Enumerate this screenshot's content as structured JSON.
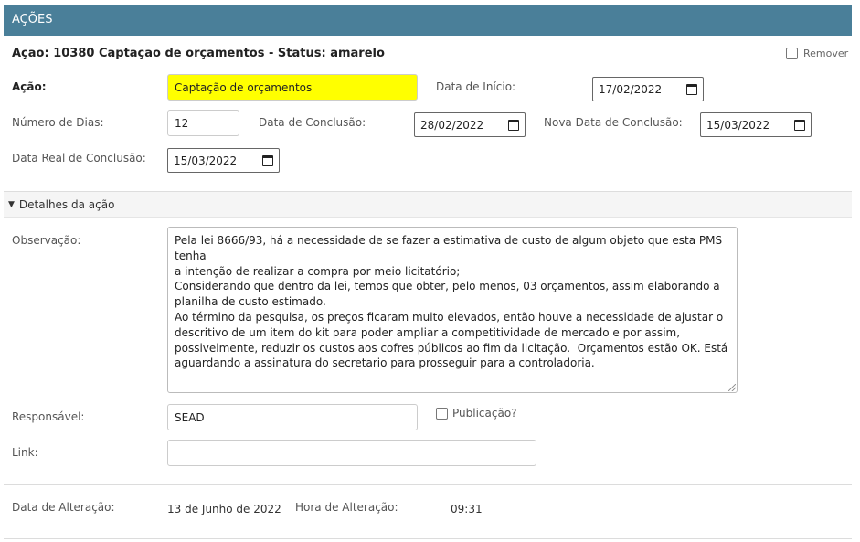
{
  "header": {
    "title": "AÇÕES"
  },
  "action": {
    "title": "Ação: 10380 Captação de orçamentos - Status: amarelo",
    "remove_label": "Remover",
    "acao_label": "Ação:",
    "acao_value": "Captação de orçamentos",
    "data_inicio_label": "Data de Início:",
    "data_inicio_value": "17/02/2022",
    "numero_dias_label": "Número de Dias:",
    "numero_dias_value": "12",
    "data_conclusao_label": "Data de Conclusão:",
    "data_conclusao_value": "28/02/2022",
    "nova_data_label": "Nova Data de Conclusão:",
    "nova_data_value": "15/03/2022",
    "data_real_label": "Data Real de Conclusão:",
    "data_real_value": "15/03/2022"
  },
  "details": {
    "toggle_label": "Detalhes da ação",
    "observacao_label": "Observação:",
    "observacao_lines": [
      "Pela lei 8666/93, há a necessidade de se fazer a estimativa de custo de algum objeto que esta PMS tenha",
      "a intenção de realizar a compra por meio licitatório;",
      "Considerando que dentro da lei, temos que obter, pelo menos, 03 orçamentos, assim elaborando a",
      "planilha de custo estimado.",
      "Ao término da pesquisa, os preços ficaram muito elevados, então houve a necessidade de ajustar o",
      "descritivo de um item do kit para poder ampliar a competitividade de mercado e por assim,",
      "possivelmente, reduzir os custos aos cofres públicos ao fim da licitação.  Orçamentos estão OK. Está",
      "aguardando a assinatura do secretario para prosseguir para a controladoria."
    ],
    "responsavel_label": "Responsável:",
    "responsavel_value": "SEAD",
    "publicacao_label": "Publicação?",
    "link_label": "Link:",
    "link_value": ""
  },
  "footer": {
    "data_alteracao_label": "Data de Alteração:",
    "data_alteracao_value": "13 de Junho de 2022",
    "hora_alteracao_label": "Hora de Alteração:",
    "hora_alteracao_value": "09:31"
  }
}
